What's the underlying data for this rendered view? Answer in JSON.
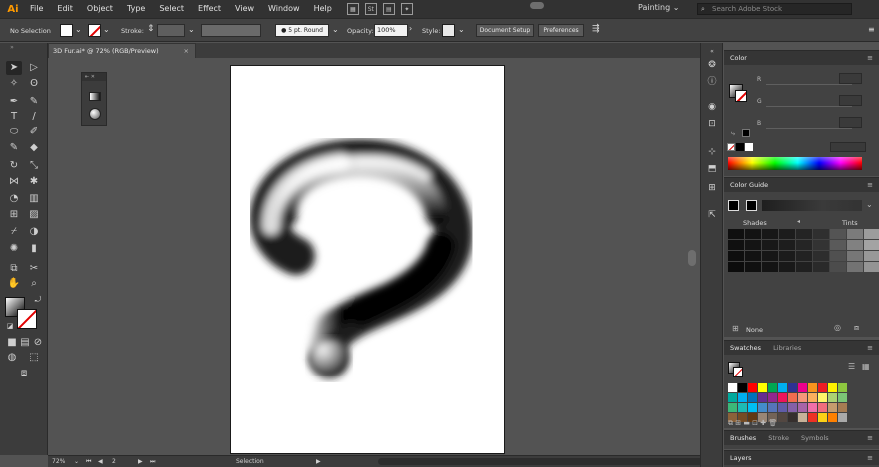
{
  "app": {
    "logo": "Ai",
    "workspace": "Painting ⌄",
    "search_placeholder": "Search Adobe Stock"
  },
  "menu": [
    "File",
    "Edit",
    "Object",
    "Type",
    "Select",
    "Effect",
    "View",
    "Window",
    "Help"
  ],
  "menubar_icons": [
    "St"
  ],
  "control": {
    "selection_label": "No Selection",
    "stroke_label": "Stroke:",
    "brush_label": "5 pt. Round",
    "opacity_label": "Opacity:",
    "opacity_value": "100%",
    "style_label": "Style:",
    "document_setup": "Document Setup",
    "preferences": "Preferences"
  },
  "document": {
    "tab_title": "3D Fur.ai* @ 72% (RGB/Preview)",
    "close": "×"
  },
  "status": {
    "zoom": "72%",
    "artboard": "2",
    "tool": "Selection"
  },
  "panels": {
    "color": {
      "title": "Color",
      "menu": "≡",
      "sliders": [
        "R",
        "G",
        "B"
      ]
    },
    "color_guide": {
      "title": "Color Guide",
      "menu": "≡",
      "shades": "Shades",
      "tints": "Tints",
      "none": "None"
    },
    "swatches": {
      "title": "Swatches",
      "tab2": "Libraries",
      "menu": "≡"
    },
    "brushes": {
      "title": "Brushes",
      "tab2": "Stroke",
      "tab3": "Symbols",
      "menu": "≡"
    },
    "layers": {
      "title": "Layers",
      "menu": "≡"
    }
  },
  "colors": {
    "guide_shades": [
      [
        "#0f0f0f",
        "#131313",
        "#171717",
        "#1c1c1c",
        "#242424",
        "#2f2f2f",
        "#545454",
        "#7b7b7b",
        "#9c9c9c"
      ],
      [
        "#101010",
        "#141414",
        "#181818",
        "#1d1d1d",
        "#252525",
        "#333333",
        "#5a5a5a",
        "#818181",
        "#a3a3a3"
      ],
      [
        "#0e0e0e",
        "#121212",
        "#161616",
        "#1b1b1b",
        "#222222",
        "#2d2d2d",
        "#505050",
        "#777777",
        "#989898"
      ],
      [
        "#0c0c0c",
        "#101010",
        "#141414",
        "#191919",
        "#202020",
        "#2a2a2a",
        "#4c4c4c",
        "#737373",
        "#949494"
      ]
    ],
    "swatches": [
      "#ffffff",
      "#000000",
      "#ff0000",
      "#ffff00",
      "#00a651",
      "#00aeef",
      "#2e3192",
      "#ec008c",
      "#f7941d",
      "#ed1c24",
      "#fff200",
      "#8dc63f",
      "#00a99d",
      "#00aeef",
      "#0072bc",
      "#662d91",
      "#92278f",
      "#ed145b",
      "#f26c4f",
      "#f69679",
      "#fbaf5d",
      "#fff568",
      "#acd372",
      "#7cc576",
      "#3cb878",
      "#1cbbb4",
      "#00bff3",
      "#448ccb",
      "#5674b9",
      "#605ca8",
      "#8560a8",
      "#a864a8",
      "#f06ea9",
      "#f26d7d",
      "#c69c6d",
      "#a67c52",
      "#8c6239",
      "#754c24",
      "#603913",
      "#998675",
      "#736357",
      "#534741",
      "#362f2d",
      "#c7b299",
      "#ee3124",
      "#fcd116",
      "#ff8000",
      "#a9a9a9"
    ]
  }
}
